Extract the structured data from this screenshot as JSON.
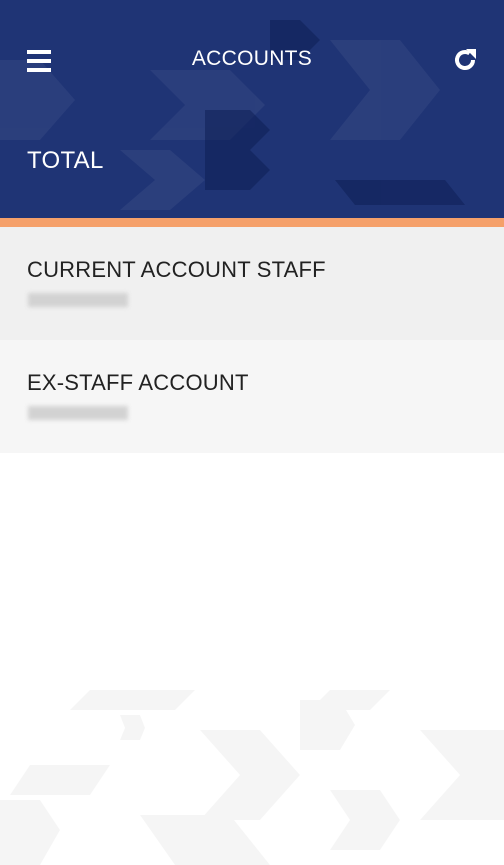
{
  "header": {
    "title": "ACCOUNTS",
    "total_label": "TOTAL",
    "background_color": "#1f3475",
    "accent_color": "#f5a06a",
    "menu_icon": "hamburger-menu-icon",
    "refresh_icon": "refresh-icon"
  },
  "accounts": [
    {
      "name": "CURRENT ACCOUNT STAFF",
      "value_state": "blurred"
    },
    {
      "name": "EX-STAFF ACCOUNT",
      "value_state": "blurred"
    }
  ]
}
